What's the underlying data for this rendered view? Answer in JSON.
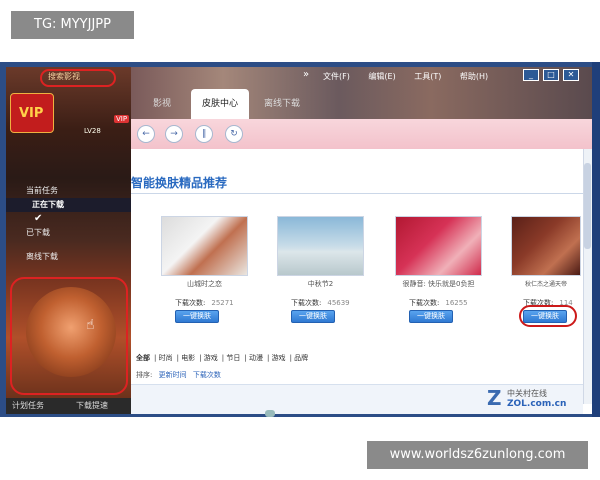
{
  "watermarks": {
    "top": "TG: MYYJJPP",
    "bottom": "www.worldsz6zunlong.com"
  },
  "left_panel": {
    "search_text": "搜索影视",
    "logo_text": "VIP",
    "level": "LV28",
    "vip_badge": "VIP",
    "menu": {
      "item1": "当前任务",
      "item2": "正在下载",
      "item3": "已下载",
      "item4": "离线下载"
    },
    "bottom": {
      "plan": "计划任务",
      "speed": "下载提速"
    }
  },
  "window": {
    "menu": {
      "chevrons": "»",
      "file": "文件(F)",
      "edit": "编辑(E)",
      "tools": "工具(T)",
      "help": "帮助(H)"
    },
    "buttons": {
      "min": "_",
      "max": "□",
      "close": "✕"
    },
    "tabs": {
      "left_dim": "影视",
      "active": "皮肤中心",
      "right_dim": "离线下载"
    },
    "toolbar": {
      "back": "←",
      "forward": "→",
      "pause": "∥",
      "refresh": "↻"
    },
    "section_title": "智能换肤精品推荐",
    "apply_label": "一键换肤",
    "count_label": "下载次数:",
    "skins": [
      {
        "name": "山城时之恋",
        "count": "25271",
        "thumb": "thumb1"
      },
      {
        "name": "中秋节2",
        "count": "45639",
        "thumb": "thumb2"
      },
      {
        "name": "很静音: 快乐就是0负担",
        "count": "16255",
        "thumb": "thumb3"
      },
      {
        "name": "秋仁杰之通天帝",
        "count": "114",
        "thumb": "thumb4"
      }
    ],
    "filters": [
      "全部",
      "时尚",
      "电影",
      "游戏",
      "节日",
      "动漫",
      "游戏",
      "品牌"
    ],
    "sort": {
      "label": "排序:",
      "by_time": "更新时间",
      "by_downloads": "下载次数"
    },
    "zol": {
      "mark": "Z",
      "text": "中关村在线",
      "domain": "ZOL.com.cn"
    }
  }
}
